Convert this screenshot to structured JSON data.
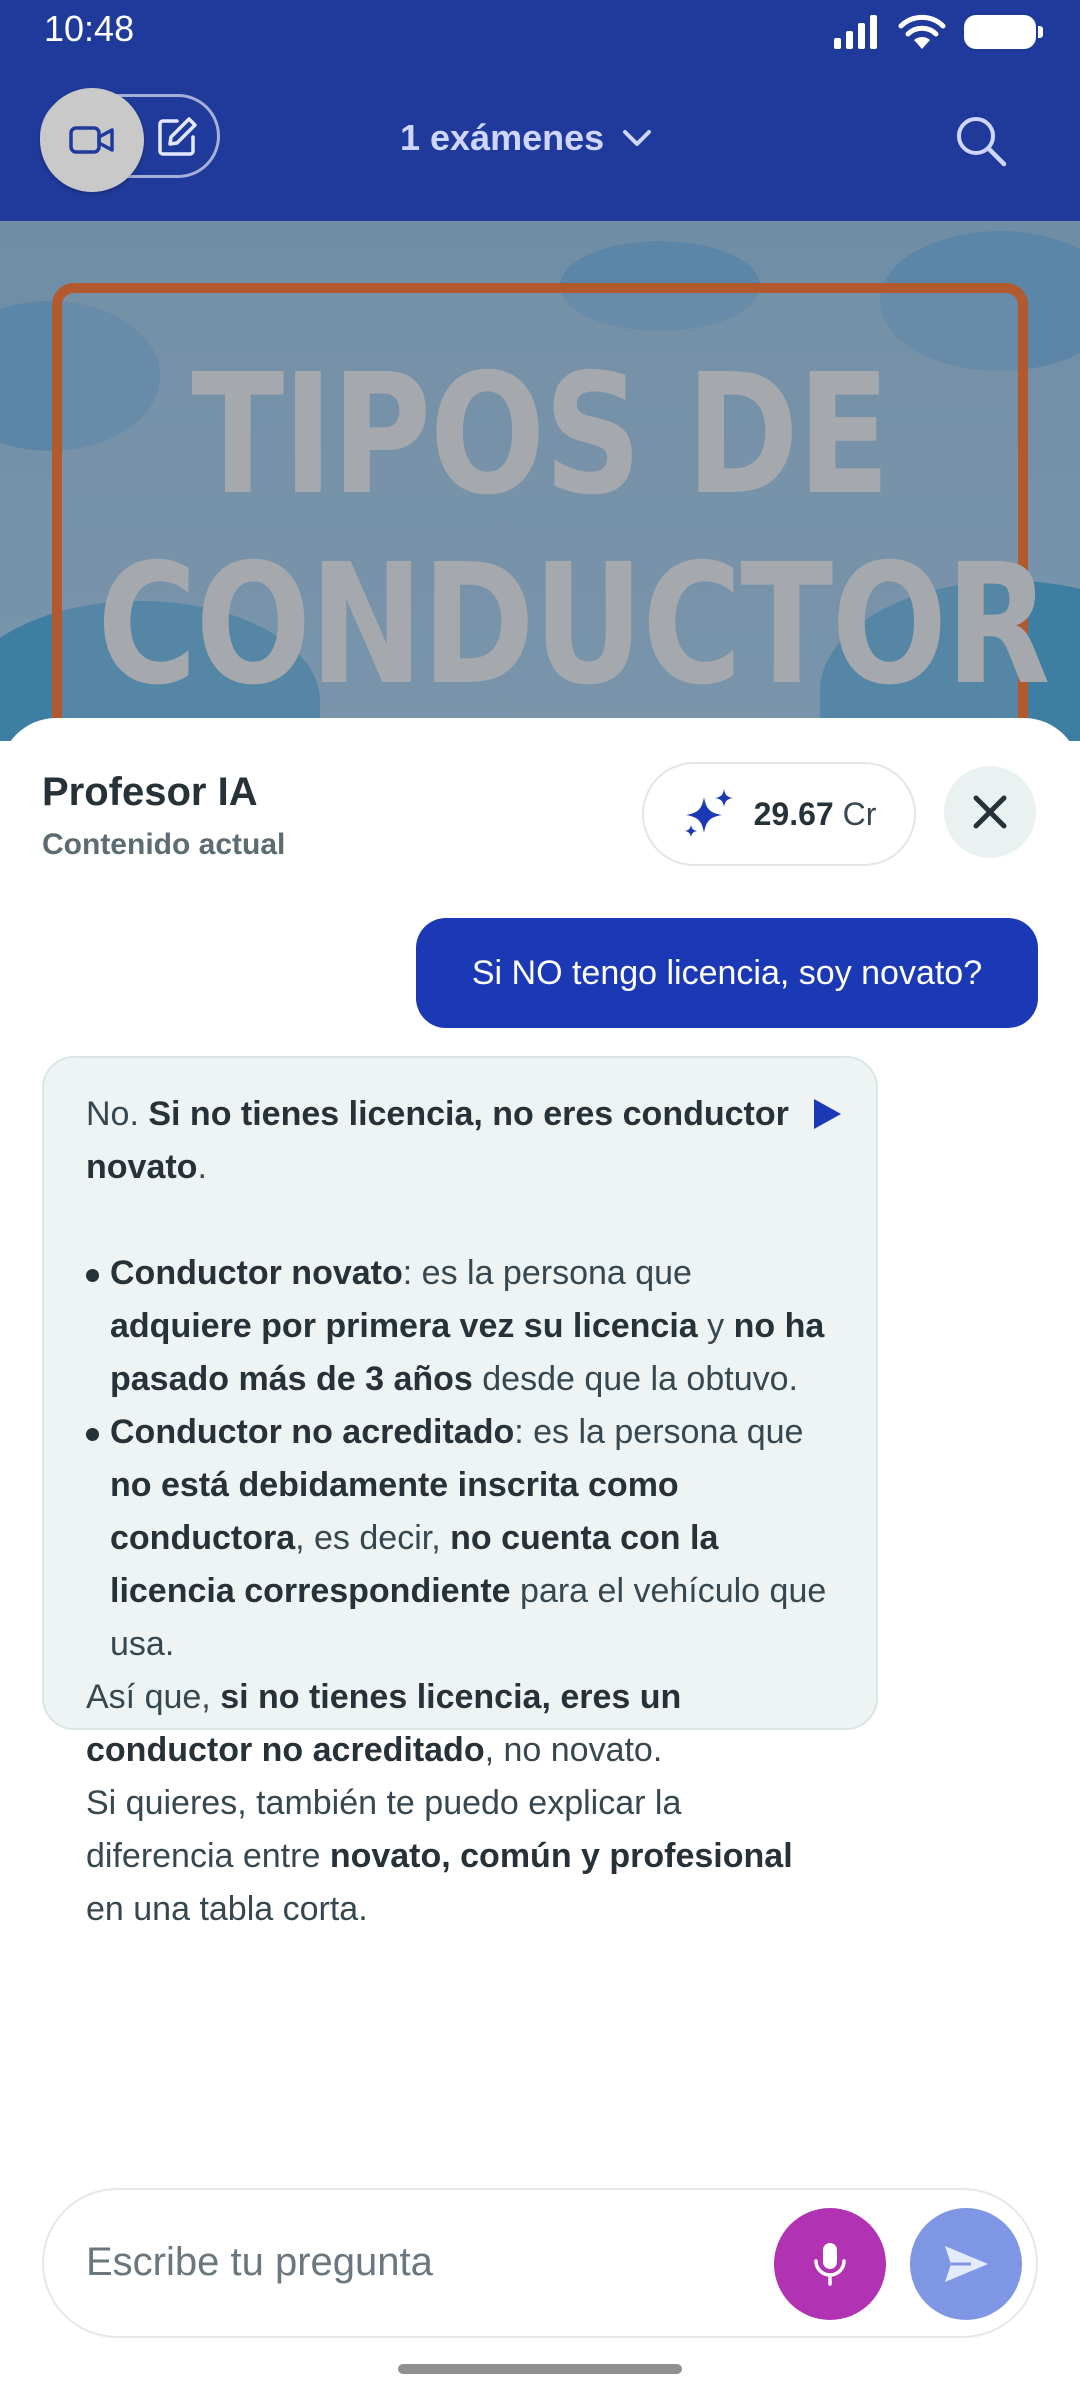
{
  "status_bar": {
    "time": "10:48"
  },
  "header": {
    "exam_selector_label": "1 exámenes",
    "icons": {
      "video": "video-camera-icon",
      "edit": "edit-note-icon",
      "search": "search-icon",
      "chevron": "chevron-down-icon"
    }
  },
  "banner": {
    "title_line1": "TIPOS DE",
    "title_line2": "CONDUCTOR"
  },
  "assistant": {
    "title": "Profesor IA",
    "subtitle": "Contenido actual",
    "credits_value": "29.67",
    "credits_unit": "Cr",
    "credits_icon": "sparkles-icon"
  },
  "chat": {
    "user_message": "Si NO tengo licencia, soy novato?",
    "ai_message": {
      "intro_normal": "No. ",
      "intro_bold": "Si no tienes licencia, no eres conductor novato",
      "intro_end": ".",
      "bullets": [
        {
          "term": "Conductor novato",
          "parts": [
            {
              "text": ": es la persona que ",
              "bold": false
            },
            {
              "text": "adquiere por primera vez su licencia",
              "bold": true
            },
            {
              "text": " y ",
              "bold": false
            },
            {
              "text": "no ha pasado más de 3 años",
              "bold": true
            },
            {
              "text": " desde que la obtuvo.",
              "bold": false
            }
          ]
        },
        {
          "term": "Conductor no acreditado",
          "parts": [
            {
              "text": ": es la persona que ",
              "bold": false
            },
            {
              "text": "no está debidamente inscrita como conductora",
              "bold": true
            },
            {
              "text": ", es decir, ",
              "bold": false
            },
            {
              "text": "no cuenta con la licencia correspondiente",
              "bold": true
            },
            {
              "text": " para el vehículo que usa.",
              "bold": false
            }
          ]
        }
      ],
      "conclusion_normal": "Así que, ",
      "conclusion_bold": "si no tienes licencia, eres un conductor no acreditado",
      "conclusion_end": ", no novato.",
      "offer_normal": "Si quieres, también te puedo explicar la diferencia entre ",
      "offer_bold": "novato, común y profesional",
      "offer_end": " en una tabla corta."
    }
  },
  "input": {
    "placeholder": "Escribe tu pregunta"
  },
  "colors": {
    "header_bg": "#1f3a9a",
    "user_bubble": "#1b38b5",
    "ai_bubble": "#eef4f4",
    "mic_button": "#b232b4",
    "send_button": "#7f96e4"
  }
}
